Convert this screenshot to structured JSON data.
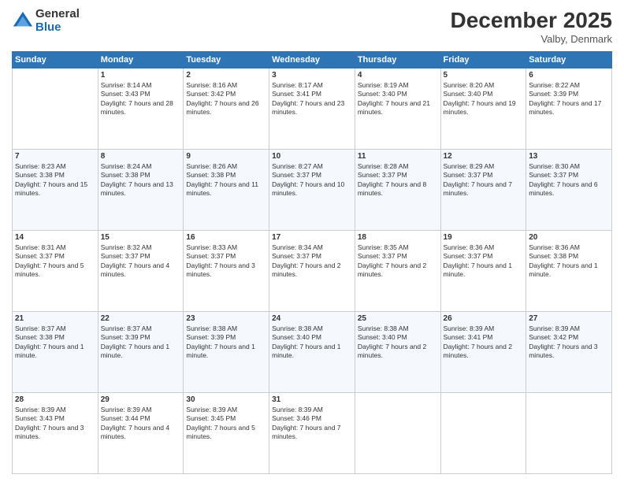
{
  "header": {
    "logo": {
      "general": "General",
      "blue": "Blue"
    },
    "title": "December 2025",
    "location": "Valby, Denmark"
  },
  "weekdays": [
    "Sunday",
    "Monday",
    "Tuesday",
    "Wednesday",
    "Thursday",
    "Friday",
    "Saturday"
  ],
  "weeks": [
    [
      {
        "day": "",
        "sunrise": "",
        "sunset": "",
        "daylight": ""
      },
      {
        "day": "1",
        "sunrise": "Sunrise: 8:14 AM",
        "sunset": "Sunset: 3:43 PM",
        "daylight": "Daylight: 7 hours and 28 minutes."
      },
      {
        "day": "2",
        "sunrise": "Sunrise: 8:16 AM",
        "sunset": "Sunset: 3:42 PM",
        "daylight": "Daylight: 7 hours and 26 minutes."
      },
      {
        "day": "3",
        "sunrise": "Sunrise: 8:17 AM",
        "sunset": "Sunset: 3:41 PM",
        "daylight": "Daylight: 7 hours and 23 minutes."
      },
      {
        "day": "4",
        "sunrise": "Sunrise: 8:19 AM",
        "sunset": "Sunset: 3:40 PM",
        "daylight": "Daylight: 7 hours and 21 minutes."
      },
      {
        "day": "5",
        "sunrise": "Sunrise: 8:20 AM",
        "sunset": "Sunset: 3:40 PM",
        "daylight": "Daylight: 7 hours and 19 minutes."
      },
      {
        "day": "6",
        "sunrise": "Sunrise: 8:22 AM",
        "sunset": "Sunset: 3:39 PM",
        "daylight": "Daylight: 7 hours and 17 minutes."
      }
    ],
    [
      {
        "day": "7",
        "sunrise": "Sunrise: 8:23 AM",
        "sunset": "Sunset: 3:38 PM",
        "daylight": "Daylight: 7 hours and 15 minutes."
      },
      {
        "day": "8",
        "sunrise": "Sunrise: 8:24 AM",
        "sunset": "Sunset: 3:38 PM",
        "daylight": "Daylight: 7 hours and 13 minutes."
      },
      {
        "day": "9",
        "sunrise": "Sunrise: 8:26 AM",
        "sunset": "Sunset: 3:38 PM",
        "daylight": "Daylight: 7 hours and 11 minutes."
      },
      {
        "day": "10",
        "sunrise": "Sunrise: 8:27 AM",
        "sunset": "Sunset: 3:37 PM",
        "daylight": "Daylight: 7 hours and 10 minutes."
      },
      {
        "day": "11",
        "sunrise": "Sunrise: 8:28 AM",
        "sunset": "Sunset: 3:37 PM",
        "daylight": "Daylight: 7 hours and 8 minutes."
      },
      {
        "day": "12",
        "sunrise": "Sunrise: 8:29 AM",
        "sunset": "Sunset: 3:37 PM",
        "daylight": "Daylight: 7 hours and 7 minutes."
      },
      {
        "day": "13",
        "sunrise": "Sunrise: 8:30 AM",
        "sunset": "Sunset: 3:37 PM",
        "daylight": "Daylight: 7 hours and 6 minutes."
      }
    ],
    [
      {
        "day": "14",
        "sunrise": "Sunrise: 8:31 AM",
        "sunset": "Sunset: 3:37 PM",
        "daylight": "Daylight: 7 hours and 5 minutes."
      },
      {
        "day": "15",
        "sunrise": "Sunrise: 8:32 AM",
        "sunset": "Sunset: 3:37 PM",
        "daylight": "Daylight: 7 hours and 4 minutes."
      },
      {
        "day": "16",
        "sunrise": "Sunrise: 8:33 AM",
        "sunset": "Sunset: 3:37 PM",
        "daylight": "Daylight: 7 hours and 3 minutes."
      },
      {
        "day": "17",
        "sunrise": "Sunrise: 8:34 AM",
        "sunset": "Sunset: 3:37 PM",
        "daylight": "Daylight: 7 hours and 2 minutes."
      },
      {
        "day": "18",
        "sunrise": "Sunrise: 8:35 AM",
        "sunset": "Sunset: 3:37 PM",
        "daylight": "Daylight: 7 hours and 2 minutes."
      },
      {
        "day": "19",
        "sunrise": "Sunrise: 8:36 AM",
        "sunset": "Sunset: 3:37 PM",
        "daylight": "Daylight: 7 hours and 1 minute."
      },
      {
        "day": "20",
        "sunrise": "Sunrise: 8:36 AM",
        "sunset": "Sunset: 3:38 PM",
        "daylight": "Daylight: 7 hours and 1 minute."
      }
    ],
    [
      {
        "day": "21",
        "sunrise": "Sunrise: 8:37 AM",
        "sunset": "Sunset: 3:38 PM",
        "daylight": "Daylight: 7 hours and 1 minute."
      },
      {
        "day": "22",
        "sunrise": "Sunrise: 8:37 AM",
        "sunset": "Sunset: 3:39 PM",
        "daylight": "Daylight: 7 hours and 1 minute."
      },
      {
        "day": "23",
        "sunrise": "Sunrise: 8:38 AM",
        "sunset": "Sunset: 3:39 PM",
        "daylight": "Daylight: 7 hours and 1 minute."
      },
      {
        "day": "24",
        "sunrise": "Sunrise: 8:38 AM",
        "sunset": "Sunset: 3:40 PM",
        "daylight": "Daylight: 7 hours and 1 minute."
      },
      {
        "day": "25",
        "sunrise": "Sunrise: 8:38 AM",
        "sunset": "Sunset: 3:40 PM",
        "daylight": "Daylight: 7 hours and 2 minutes."
      },
      {
        "day": "26",
        "sunrise": "Sunrise: 8:39 AM",
        "sunset": "Sunset: 3:41 PM",
        "daylight": "Daylight: 7 hours and 2 minutes."
      },
      {
        "day": "27",
        "sunrise": "Sunrise: 8:39 AM",
        "sunset": "Sunset: 3:42 PM",
        "daylight": "Daylight: 7 hours and 3 minutes."
      }
    ],
    [
      {
        "day": "28",
        "sunrise": "Sunrise: 8:39 AM",
        "sunset": "Sunset: 3:43 PM",
        "daylight": "Daylight: 7 hours and 3 minutes."
      },
      {
        "day": "29",
        "sunrise": "Sunrise: 8:39 AM",
        "sunset": "Sunset: 3:44 PM",
        "daylight": "Daylight: 7 hours and 4 minutes."
      },
      {
        "day": "30",
        "sunrise": "Sunrise: 8:39 AM",
        "sunset": "Sunset: 3:45 PM",
        "daylight": "Daylight: 7 hours and 5 minutes."
      },
      {
        "day": "31",
        "sunrise": "Sunrise: 8:39 AM",
        "sunset": "Sunset: 3:46 PM",
        "daylight": "Daylight: 7 hours and 7 minutes."
      },
      {
        "day": "",
        "sunrise": "",
        "sunset": "",
        "daylight": ""
      },
      {
        "day": "",
        "sunrise": "",
        "sunset": "",
        "daylight": ""
      },
      {
        "day": "",
        "sunrise": "",
        "sunset": "",
        "daylight": ""
      }
    ]
  ]
}
